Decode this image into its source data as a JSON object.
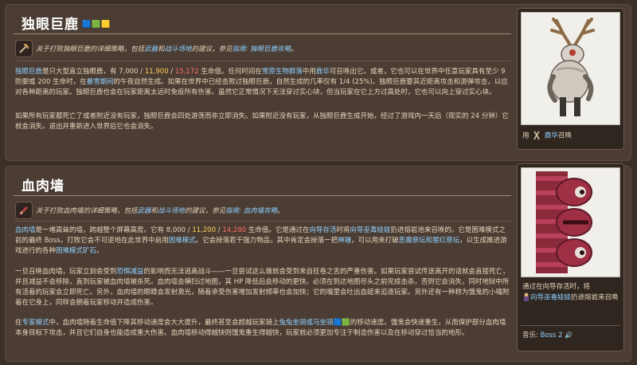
{
  "deerclops": {
    "title": "独眼巨鹿",
    "badges": "🟦🟩🟨",
    "tip_prefix": "关于打败独眼巨鹿的详细策略，包括",
    "tip_link1": "武器",
    "tip_mid": "和",
    "tip_link2": "战斗场地",
    "tip_mid2": "的建议，参见",
    "tip_link3": "指南: 独眼巨鹿攻略",
    "tip_end": "。",
    "p1_name": "独眼巨鹿",
    "p1_a": "是只大型直立独眼鹿，有",
    "hp_1": "7,000",
    "hp_sep": " / ",
    "hp_2": "11,900",
    "hp_3": "15,172",
    "p1_b": "生命值。任何时间在",
    "p1_link_biome": "雪原生物群落",
    "p1_c": "中用",
    "p1_link_item": "鹿华",
    "p1_d": "可召唤出它。或者，它也可以在世界中任意玩家具有至少 9 防御或 200 生命时，在",
    "p1_link_time": "暴雪期间",
    "p1_e": "的午夜自然生成。如果在世界中已经击败过独眼巨鹿，自然生成的几率仅有 1/4 (25%)。独眼巨鹿要其近距离攻击和游弹攻击，以应对各种距离的玩家。独眼巨鹿也会在玩家距离太远时免疫所有伤害。虽然它正常情况下无法穿过实心块，但当玩家在它上方过高处时，它也可以向上穿过实心块。",
    "p2": "如果所有玩家都死亡了或者附近没有玩家，独眼巨鹿会四处游荡而非立即消失。如果附近没有玩家，从独眼巨鹿生成开始，经过了游戏内一天后（现实的 24 分钟）它就会消失。退出并重新进入世界后它也会消失。",
    "summon_prefix": "用",
    "summon_link": "鹿华",
    "summon_suffix": "召唤"
  },
  "wof": {
    "title": "血肉墙",
    "tip_prefix": "关于打败血肉墙的详细策略，包括",
    "tip_link1": "武器",
    "tip_mid": "和",
    "tip_link2": "战斗场地",
    "tip_mid2": "的建议，参见",
    "tip_link3": "指南: 血肉墙攻略",
    "tip_end": "。",
    "p1_name": "血肉墙",
    "p1_a": "是一堵高耸的墙，跨越整个屏幕高度。它有",
    "hp_1": "8,000",
    "hp_sep": " / ",
    "hp_2": "11,200",
    "hp_3": "14,280",
    "p1_b": "生命值。它是通过在",
    "p1_link_hell": "向导存活",
    "p1_c": "时将",
    "p1_link_doll": "向导巫毒娃娃",
    "p1_d": "扔进熔岩池来召唤的。它是困难模式之前的最终 Boss，打败它会不可逆地在此世界中启用",
    "p1_link_hard": "困难模式",
    "p1_e": "。它会掉落若干强力物品，其中肯定会掉落一把",
    "p1_link_hammer": "神锤",
    "p1_f": "，可以用来打破",
    "p1_link_altar": "恶魔祭坛和猩红祭坛",
    "p1_g": "，以生成推进游戏进行的各种",
    "p1_link_ore": "困难模式矿石",
    "p1_h": "。",
    "p2": "一旦召唤血肉墙，玩家立刻会受到",
    "p2_link": "恐惧减益",
    "p2_b": "的影响而无法逃离战斗——一旦尝试这么做就会受到来自狂卷之舌的严重伤害。如果玩家尝试传送离开的话就会直接死亡，并且减益不会移除，直到玩家被血肉墙被杀死。血肉墙会横扫过地图，其 HP 降低后会移动的更快。必须在到达地图尽头之前完成击杀，否则它会消失，同时地狱中所有活着的玩家会立即死亡。另外，血肉墙的眼睛会发射激光，随着承受伤害增加发射频率也会加快；它的嘴里会吐出血蛭来追逐玩家。另外还有一种称为饿鬼的小嘴附着在它身上，同样会朝着玩家移动并造成伤害。",
    "p3_a": "在",
    "p3_link_expert": "专家模式",
    "p3_b": "中，血肉墙随着生命值下降其移动速度会大大提升，最终甚至会超越玩家骑上",
    "p3_link_mount": "兔兔坐骑或马坐骑",
    "p3_c": "🟦🟩的移动速度。饿鬼会快速重生，从而保护部分血肉墙本身目标下攻击，并且它们自身也能造成重大伤害。血肉墙移动得越快则饿鬼重生得越快，玩家就必须更加专注于制造伤害以及在移动穿过恰当的地形。",
    "info_a": "通过在向导存活时，将",
    "info_link": "向导巫毒娃娃",
    "info_b": "扔进熔岩来召唤",
    "music_label": "音乐:",
    "music_value": "Boss 2",
    "music_icon": "🔊"
  },
  "colors": {
    "link": "#8fd0ff",
    "gold": "#ffd15b",
    "red": "#ff6b6b"
  }
}
